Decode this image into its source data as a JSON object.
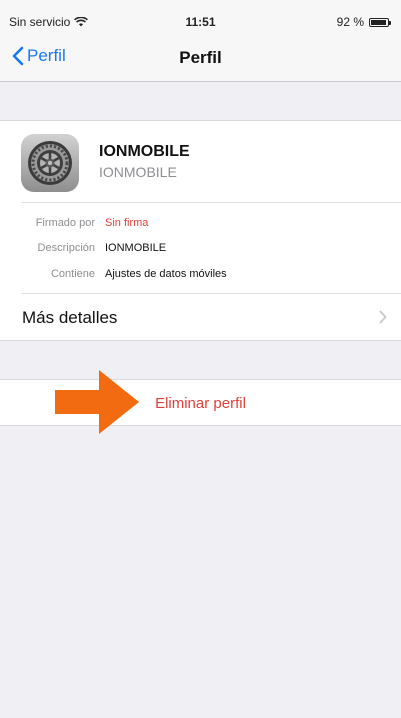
{
  "status_bar": {
    "carrier": "Sin servicio",
    "time": "11:51",
    "battery": "92 %"
  },
  "nav": {
    "back_label": "Perfil",
    "title": "Perfil"
  },
  "profile": {
    "name": "IONMOBILE",
    "subtitle": "IONMOBILE",
    "icon": "settings-gear-icon",
    "fields": [
      {
        "key": "Firmado por",
        "value": "Sin firma",
        "value_color": "#e0403a"
      },
      {
        "key": "Descripción",
        "value": "IONMOBILE"
      },
      {
        "key": "Contiene",
        "value": "Ajustes de datos móviles"
      }
    ],
    "more_details_label": "Más detalles"
  },
  "actions": {
    "delete_label": "Eliminar perfil"
  },
  "colors": {
    "accent": "#1a78f0",
    "destructive": "#e0403a",
    "annotation_arrow": "#f26b10"
  }
}
